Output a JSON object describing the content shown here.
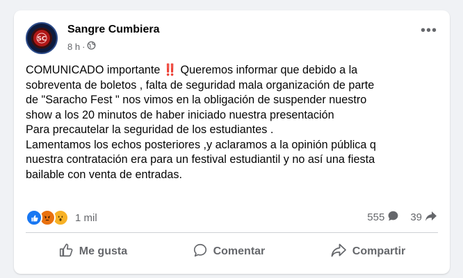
{
  "post": {
    "author": "Sangre Cumbiera",
    "time": "8 h",
    "body_lines": [
      "COMUNICADO importante ‼️ Queremos informar que debido a la",
      "sobreventa de boletos , falta de seguridad mala organización de parte",
      "de \"Saracho Fest \" nos vimos en la obligación de suspender nuestro",
      "show a los 20 minutos de haber iniciado nuestra presentación",
      "Para precautelar la seguridad de los estudiantes .",
      "Lamentamos los echos posteriores ,y aclaramos a la opinión pública q",
      "nuestra contratación era para un festival estudiantil y no así una fiesta",
      "bailable con venta de entradas."
    ],
    "reactions": {
      "types": [
        "like-icon",
        "angry-icon",
        "wow-icon"
      ],
      "count": "1 mil"
    },
    "comments_count": "555",
    "shares_count": "39"
  },
  "actions": {
    "like": "Me gusta",
    "comment": "Comentar",
    "share": "Compartir"
  },
  "colors": {
    "background": "#f0f2f5",
    "card": "#ffffff",
    "like_blue": "#1877f2",
    "angry_orange": "#e9710f",
    "wow_yellow": "#f7b125",
    "secondary_text": "#65676b"
  }
}
